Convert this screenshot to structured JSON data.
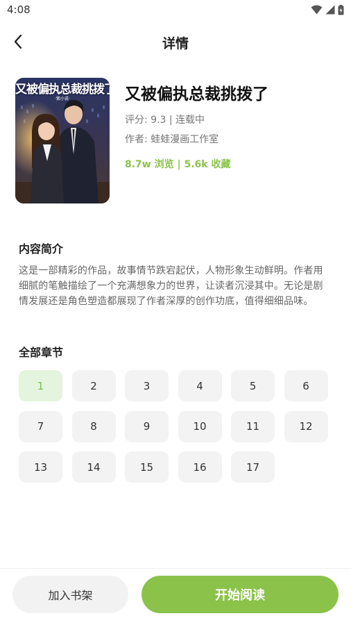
{
  "status_bar": {
    "time": "4:08",
    "icons": [
      "wifi-icon",
      "signal-icon",
      "battery-icon"
    ]
  },
  "header": {
    "title": "详情",
    "back_icon": "chevron-left-icon"
  },
  "book": {
    "cover_title": "又被偏执总裁挑拨了",
    "cover_subtitle": "·紫小说·",
    "title": "又被偏执总裁挑拨了",
    "rating": "评分: 9.3 | 连载中",
    "author": "作者: 蛙蛙漫画工作室",
    "stats": "8.7w 浏览 | 5.6k 收藏"
  },
  "intro": {
    "heading": "内容简介",
    "text": "这是一部精彩的作品，故事情节跌宕起伏，人物形象生动鲜明。作者用细腻的笔触描绘了一个充满想象力的世界，让读者沉浸其中。无论是剧情发展还是角色塑造都展现了作者深厚的创作功底，值得细细品味。"
  },
  "chapters": {
    "heading": "全部章节",
    "selected": "1",
    "items": [
      "1",
      "2",
      "3",
      "4",
      "5",
      "6",
      "7",
      "8",
      "9",
      "10",
      "11",
      "12",
      "13",
      "14",
      "15",
      "16",
      "17"
    ]
  },
  "bottom_bar": {
    "shelf_label": "加入书架",
    "read_label": "开始阅读"
  },
  "colors": {
    "accent": "#8bc34a",
    "accent_light": "#e4f4de",
    "chip_bg": "#f3f3f3"
  }
}
